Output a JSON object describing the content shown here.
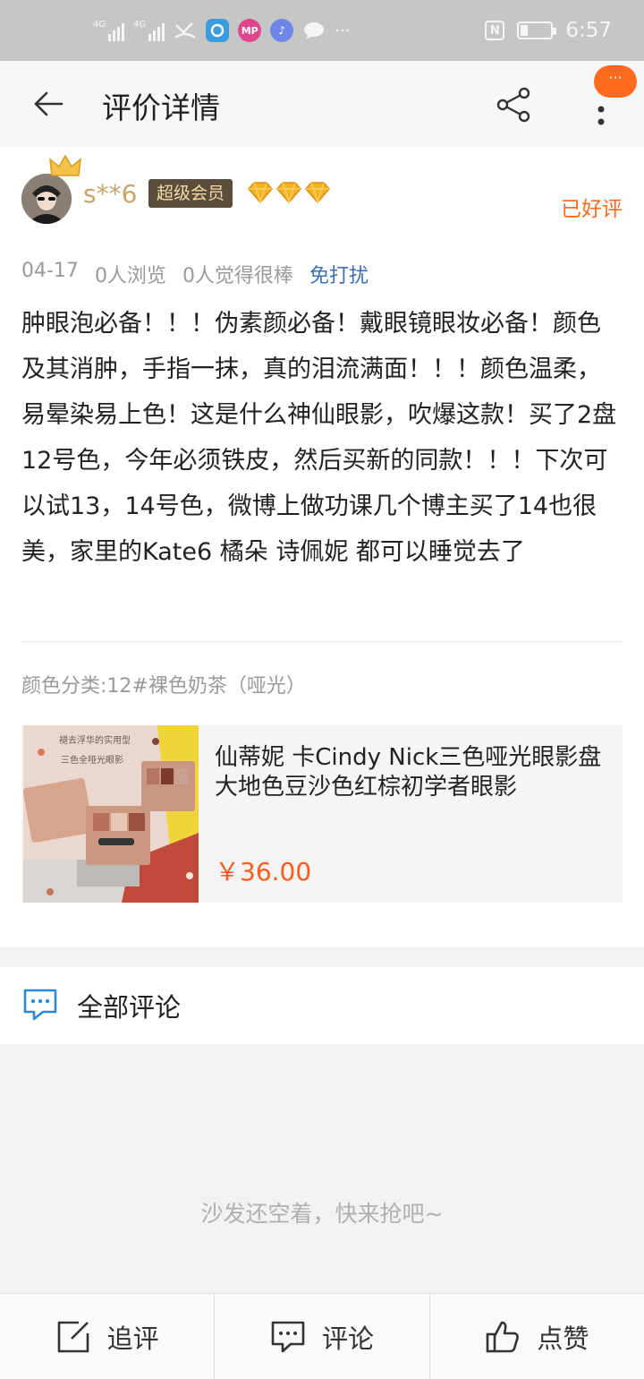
{
  "status_bar": {
    "net1": "4G",
    "net2": "4G",
    "app_badge": "MP",
    "clock": "6:57"
  },
  "header": {
    "title": "评价详情",
    "notification": "···"
  },
  "review": {
    "username": "s**6",
    "member_badge": "超级会员",
    "rating_status": "已好评",
    "date": "04-17",
    "views": "0人浏览",
    "likes_text": "0人觉得很棒",
    "disturb": "免打扰",
    "content": "肿眼泡必备！！！伪素颜必备！戴眼镜眼妆必备！颜色及其消肿，手指一抹，真的泪流满面！！！颜色温柔，易晕染易上色！这是什么神仙眼影，吹爆这款！买了2盘12号色，今年必须铁皮，然后买新的同款！！！下次可以试13，14号色，微博上做功课几个博主买了14也很美，家里的Kate6 橘朵 诗佩妮 都可以睡觉去了",
    "sku": "颜色分类:12#裸色奶茶（哑光）"
  },
  "product": {
    "image_caption_1": "褪去浮华的实用型",
    "image_caption_2": "三色全哑光眼影",
    "name": "仙蒂妮 卡Cindy Nick三色哑光眼影盘大地色豆沙色红棕初学者眼影",
    "price": "￥36.00"
  },
  "comments": {
    "title": "全部评论",
    "empty": "沙发还空着，快来抢吧~"
  },
  "bottom_bar": {
    "follow_up": "追评",
    "comment": "评论",
    "like": "点赞"
  },
  "colors": {
    "accent": "#ff6a1f",
    "price": "#ff5a1e",
    "link": "#3d6fb5",
    "vip_bg": "#5a4d3c",
    "gold": "#c9a56b"
  }
}
